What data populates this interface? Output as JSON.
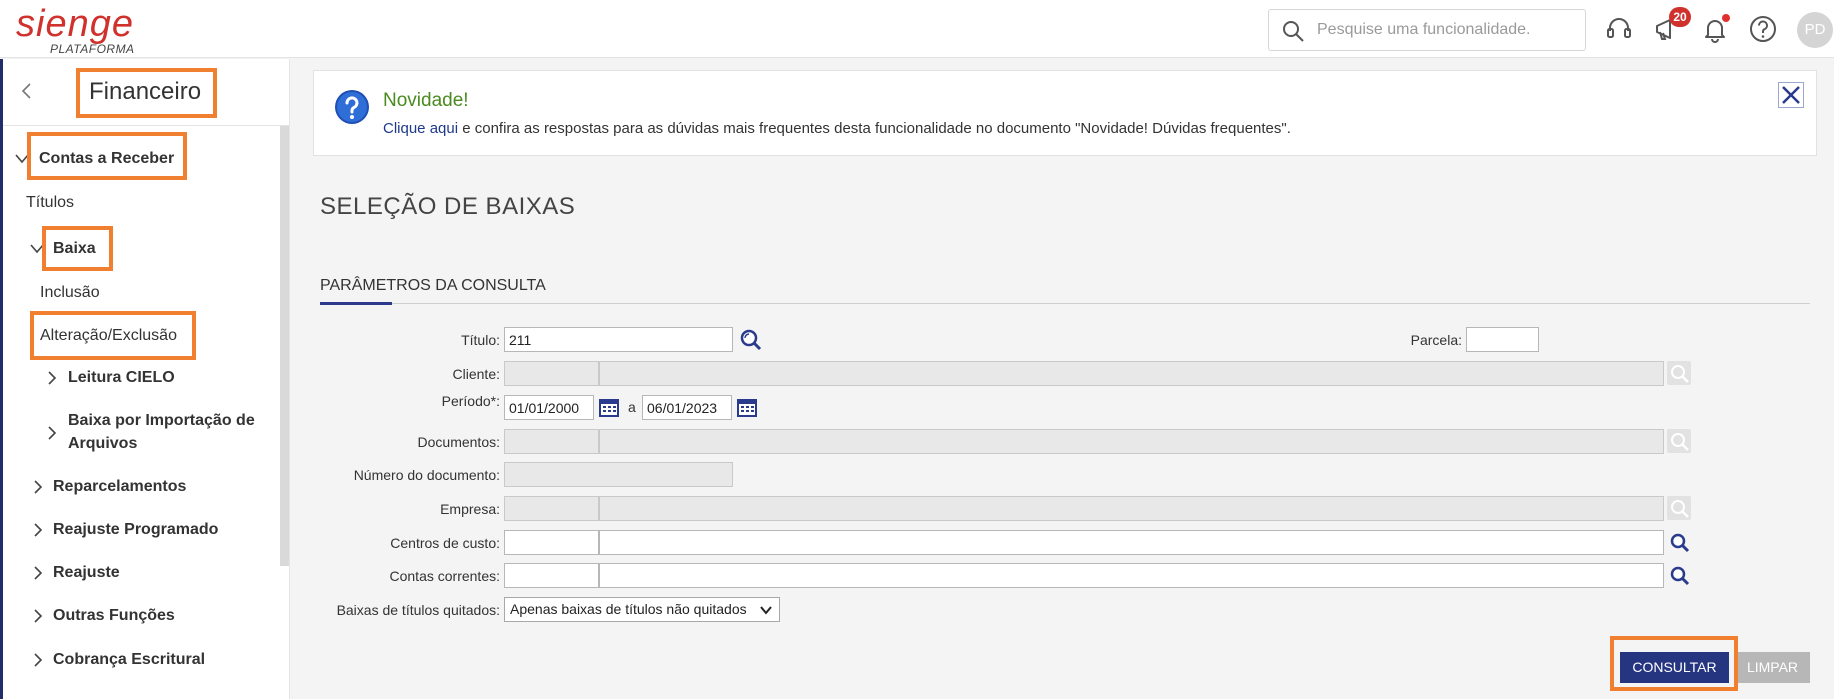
{
  "header": {
    "logo_text": "sienge",
    "logo_subtext": "PLATAFORMA",
    "search_placeholder": "Pesquise uma funcionalidade.",
    "notifications_count": "20",
    "user_initials": "PD",
    "accent_color": "#d0312d"
  },
  "sidebar": {
    "title": "Financeiro",
    "items": [
      {
        "label": "Contas a Receber"
      },
      {
        "label": "Títulos"
      },
      {
        "label": "Baixa"
      },
      {
        "label": "Inclusão"
      },
      {
        "label": "Alteração/Exclusão"
      },
      {
        "label": "Leitura CIELO"
      },
      {
        "label": "Baixa por Importação de"
      },
      {
        "label": "Arquivos"
      },
      {
        "label": "Reparcelamentos"
      },
      {
        "label": "Reajuste Programado"
      },
      {
        "label": "Reajuste"
      },
      {
        "label": "Outras Funções"
      },
      {
        "label": "Cobrança Escritural"
      }
    ]
  },
  "notice": {
    "title": "Novidade!",
    "link_text": "Clique aqui",
    "text": " e confira as respostas para as dúvidas mais frequentes desta funcionalidade no documento \"Novidade! Dúvidas frequentes\"."
  },
  "page": {
    "title": "SELEÇÃO DE BAIXAS",
    "section_title": "PARÂMETROS DA CONSULTA"
  },
  "form": {
    "titulo_label": "Título:",
    "titulo_value": "211",
    "parcela_label": "Parcela:",
    "parcela_value": "",
    "cliente_label": "Cliente:",
    "periodo_label": "Período*:",
    "periodo_start": "01/01/2000",
    "periodo_sep": "a",
    "periodo_end": "06/01/2023",
    "documentos_label": "Documentos:",
    "numero_documento_label": "Número do documento:",
    "empresa_label": "Empresa:",
    "centros_label": "Centros de custo:",
    "contas_label": "Contas correntes:",
    "baixas_label": "Baixas de títulos quitados:",
    "baixas_value": "Apenas baixas de títulos não quitados"
  },
  "actions": {
    "consultar": "CONSULTAR",
    "limpar": "LIMPAR"
  }
}
